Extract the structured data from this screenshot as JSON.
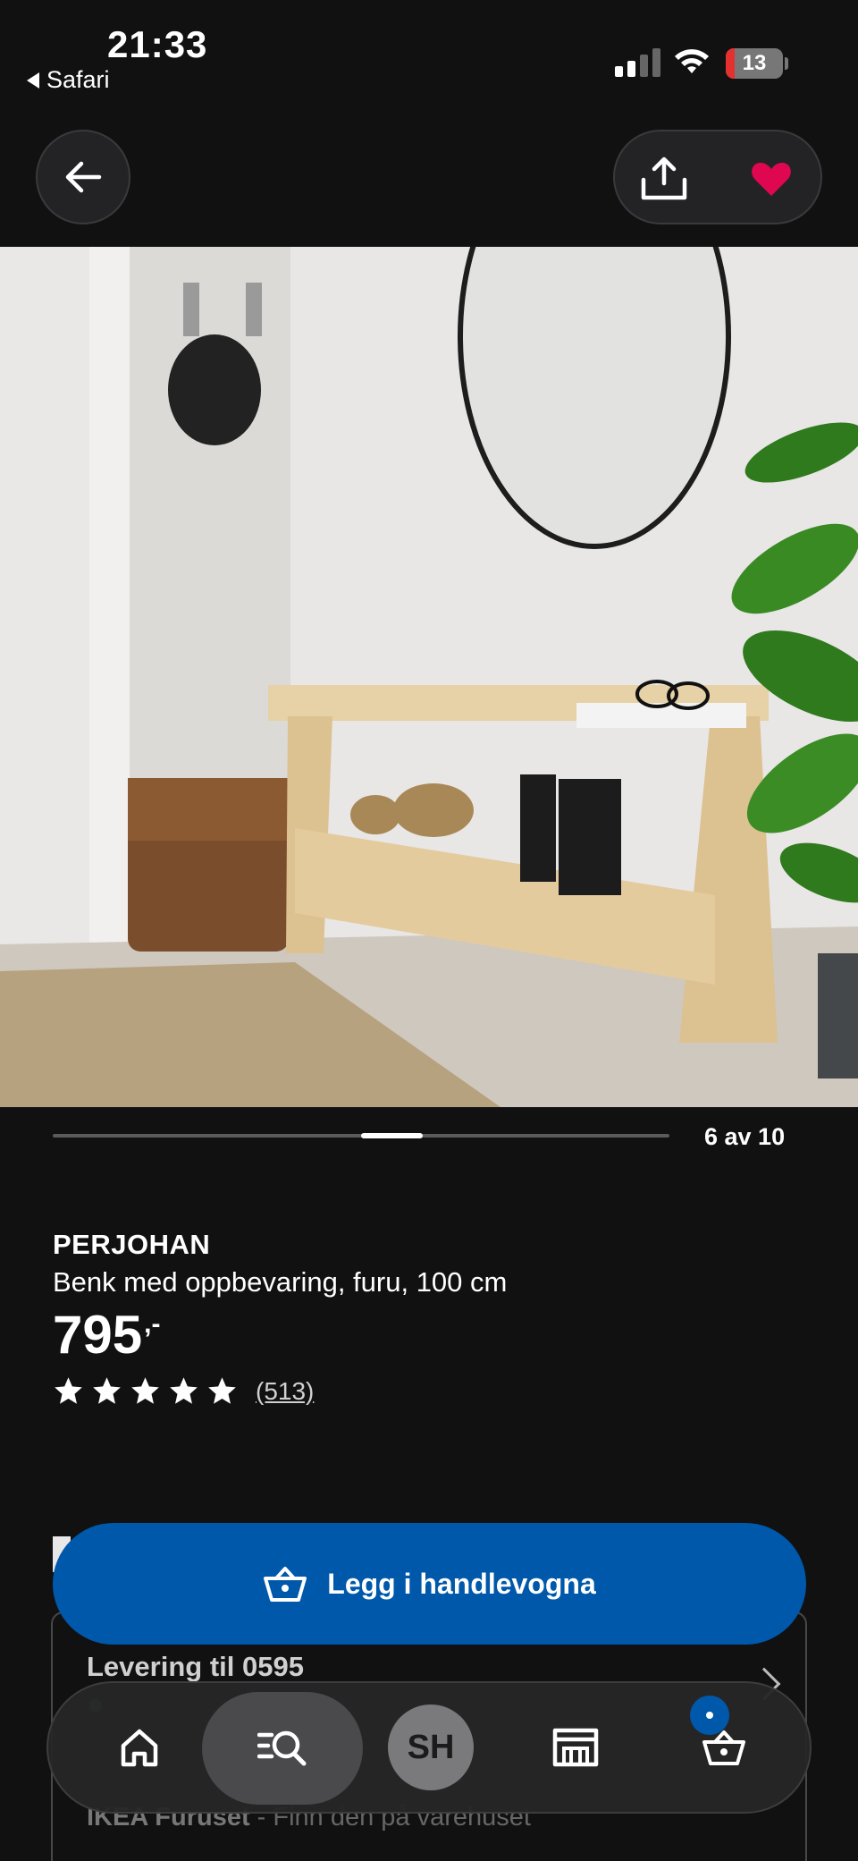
{
  "status_bar": {
    "time": "21:33",
    "back_app": "Safari",
    "battery": "13"
  },
  "toolbar": {
    "back_icon": "arrow-left-icon",
    "share_icon": "share-icon",
    "favorite_icon": "heart-icon"
  },
  "gallery": {
    "counter": "6 av 10",
    "current_index": 6,
    "total": 10
  },
  "product": {
    "name": "PERJOHAN",
    "description": "Benk med oppbevaring, furu, 100 cm",
    "price": "795",
    "price_suffix": ",-",
    "rating_stars": 5,
    "review_count": "(513)"
  },
  "cta": {
    "label": "Legg i handlevogna",
    "color": "#0058ab"
  },
  "delivery": {
    "title": "Levering til 0595",
    "store_name": "IKEA Furuset",
    "store_text": " - Finn den på varehuset"
  },
  "bottom_nav": {
    "profile_initials": "SH",
    "items": [
      "home-icon",
      "search-list-icon",
      "profile-avatar",
      "store-icon",
      "cart-icon"
    ]
  },
  "colors": {
    "background": "#111112",
    "brand_blue": "#0058ab",
    "favorite_red": "#e00751"
  }
}
